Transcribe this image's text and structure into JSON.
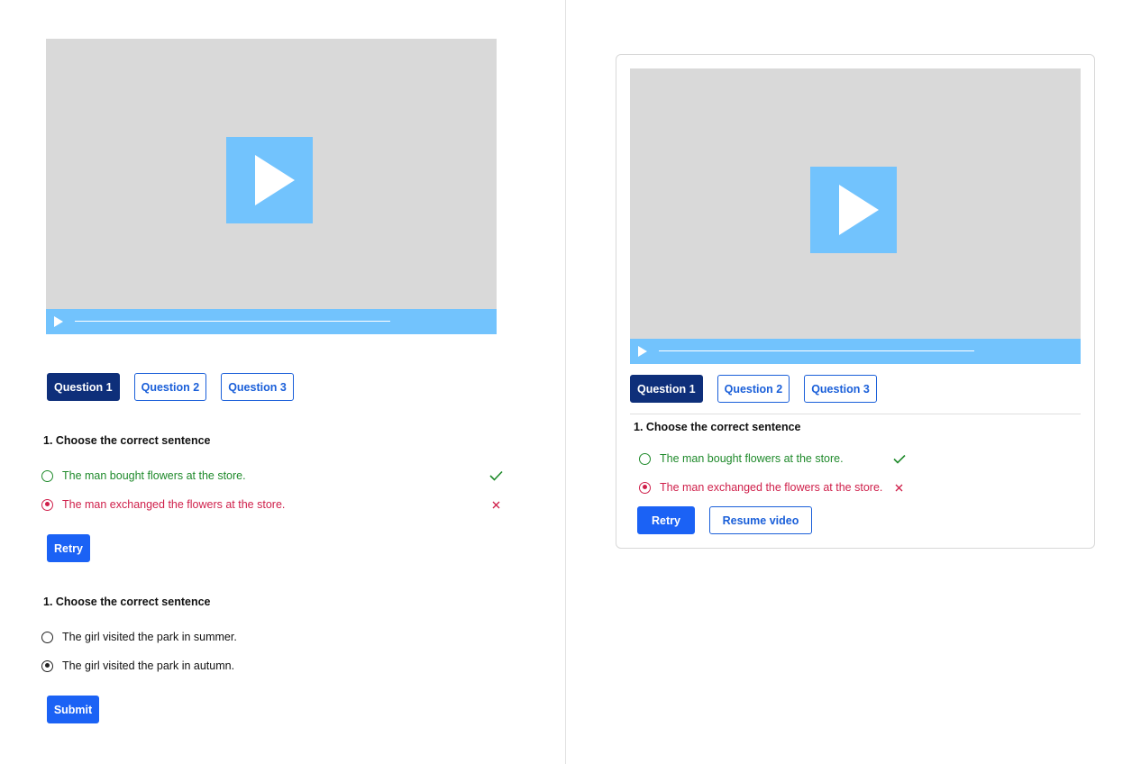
{
  "left": {
    "tabs": [
      {
        "label": "Question 1",
        "active": true
      },
      {
        "label": "Question 2",
        "active": false
      },
      {
        "label": "Question 3",
        "active": false
      }
    ],
    "question1": {
      "title": "1. Choose the correct sentence",
      "options": [
        {
          "text": "The man bought flowers at the store.",
          "state": "correct",
          "selected": false
        },
        {
          "text": "The man exchanged the flowers at the store.",
          "state": "wrong",
          "selected": true
        }
      ],
      "retry_label": "Retry"
    },
    "question2": {
      "title": "1. Choose the correct sentence",
      "options": [
        {
          "text": "The girl visited the park in summer.",
          "selected": false
        },
        {
          "text": "The girl visited the park in autumn.",
          "selected": true
        }
      ],
      "submit_label": "Submit"
    }
  },
  "right": {
    "tabs": [
      {
        "label": "Question 1",
        "active": true
      },
      {
        "label": "Question 2",
        "active": false
      },
      {
        "label": "Question 3",
        "active": false
      }
    ],
    "question": {
      "title": "1. Choose the correct sentence",
      "options": [
        {
          "text": "The man bought flowers at the store.",
          "state": "correct",
          "selected": false
        },
        {
          "text": "The man exchanged the flowers at the store.",
          "state": "wrong",
          "selected": true
        }
      ],
      "retry_label": "Retry",
      "resume_label": "Resume video"
    }
  },
  "colors": {
    "video_bg": "#d9d9d9",
    "player_accent": "#72c3fd",
    "tab_active": "#0e2f7a",
    "primary": "#1b62f5",
    "correct": "#1f8a2b",
    "wrong": "#cf1f4a"
  },
  "icons": {
    "play": "play-icon",
    "correct": "check-icon",
    "wrong": "cross-icon"
  }
}
